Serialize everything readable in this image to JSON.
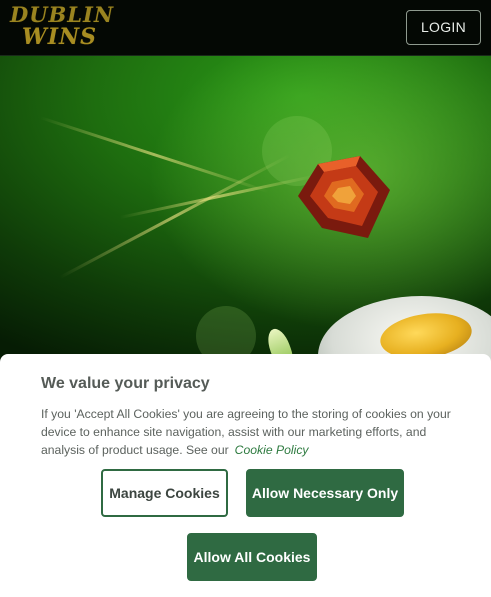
{
  "header": {
    "logo_line1": "DUBLIN",
    "logo_line2": "WINS",
    "login_label": "LOGIN"
  },
  "hero": {
    "icons": [
      "ruby-gem-icon",
      "gold-coin-icon",
      "clover-leaf-icon"
    ]
  },
  "cookie_banner": {
    "title": "We value your privacy",
    "body": "If you 'Accept All Cookies' you are agreeing to the storing of cookies on your device to enhance site navigation, assist with our marketing efforts, and analysis of product usage. See our",
    "policy_link": "Cookie Policy",
    "buttons": {
      "manage": "Manage Cookies",
      "necessary": "Allow Necessary Only",
      "all": "Allow All Cookies"
    }
  },
  "colors": {
    "brand_green": "#2f6a42",
    "logo_gold": "#9a8420",
    "header_bg": "#040804",
    "link_green": "#2d7a3f"
  }
}
